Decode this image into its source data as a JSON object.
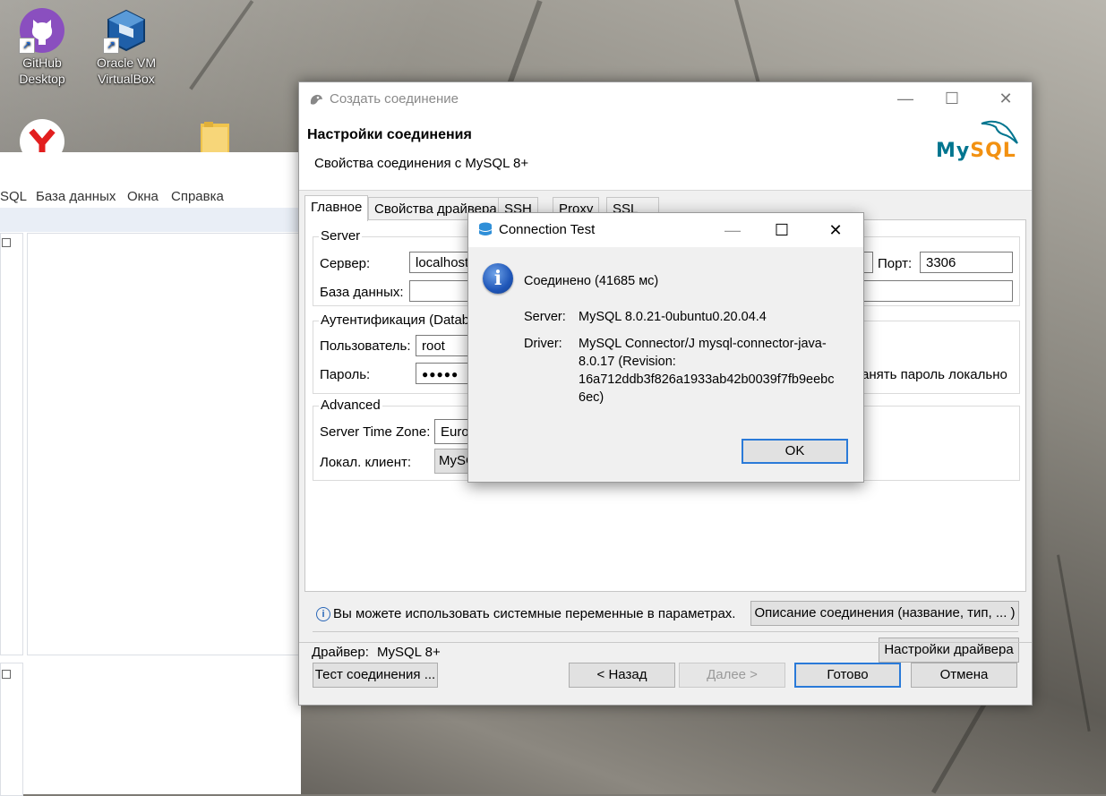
{
  "desktop": {
    "icons": [
      {
        "label_line1": "GitHub",
        "label_line2": "Desktop"
      },
      {
        "label_line1": "Oracle VM",
        "label_line2": "VirtualBox"
      }
    ]
  },
  "background_app": {
    "menu": [
      "SQL",
      "База данных",
      "Окна",
      "Справка"
    ]
  },
  "dialog": {
    "title": "Создать соединение",
    "header_title": "Настройки соединения",
    "header_subtitle": "Свойства соединения с MySQL 8+",
    "logo_text": "MySQL",
    "tabs": [
      "Главное",
      "Свойства драйвера",
      "SSH",
      "Proxy",
      "SSL"
    ],
    "server_group": {
      "title": "Server",
      "host_label": "Сервер:",
      "host_value": "localhost",
      "port_label": "Порт:",
      "port_value": "3306",
      "database_label": "База данных:",
      "database_value": ""
    },
    "auth_group": {
      "title": "Аутентификация (Datab",
      "user_label": "Пользователь:",
      "user_value": "root",
      "password_label": "Пароль:",
      "password_value": "●●●●●",
      "save_password_label": "анять пароль локально"
    },
    "advanced_group": {
      "title": "Advanced",
      "timezone_label": "Server Time Zone:",
      "timezone_value": "Europ",
      "local_client_label": "Локал. клиент:",
      "local_client_value": "MySC"
    },
    "info_text": "Вы можете использовать системные переменные в параметрах.",
    "connection_description_button": "Описание соединения (название, тип, ... )",
    "driver_label": "Драйвер:",
    "driver_value": "MySQL 8+",
    "driver_settings_button": "Настройки драйвера",
    "buttons": {
      "test": "Тест соединения ...",
      "back": "< Назад",
      "next": "Далее >",
      "finish": "Готово",
      "cancel": "Отмена"
    }
  },
  "connection_test": {
    "title": "Connection Test",
    "message": "Соединено (41685 мс)",
    "server_label": "Server:",
    "server_value": "MySQL 8.0.21-0ubuntu0.20.04.4",
    "driver_label": "Driver:",
    "driver_line1": "MySQL Connector/J mysql-connector-java-",
    "driver_line2": "8.0.17 (Revision:",
    "driver_line3": "16a712ddb3f826a1933ab42b0039f7fb9eebc",
    "driver_line4": "6ec)",
    "ok_button": "OK"
  },
  "colors": {
    "accent": "#2a7ad8",
    "mysql_blue": "#00758f",
    "mysql_orange": "#f29111"
  }
}
